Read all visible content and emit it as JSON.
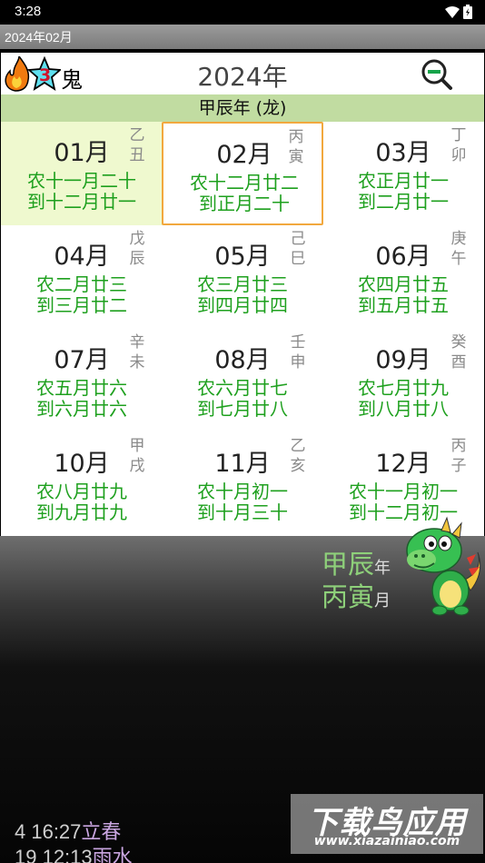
{
  "status_bar": {
    "time": "3:28"
  },
  "title_bar": {
    "title": "2024年02月"
  },
  "header": {
    "logo_text": "鬼",
    "logo_badge": "3",
    "year_title": "2024年",
    "zoom_icon": "zoom-out-icon"
  },
  "ganzhi_bar": {
    "text": "甲辰年 (龙)"
  },
  "months": [
    {
      "name": "01月",
      "gz1": "乙",
      "gz2": "丑",
      "line1": "农十一月二十",
      "line2": "到十二月廿一",
      "selected": true
    },
    {
      "name": "02月",
      "gz1": "丙",
      "gz2": "寅",
      "line1": "农十二月廿二",
      "line2": "到正月二十",
      "current": true
    },
    {
      "name": "03月",
      "gz1": "丁",
      "gz2": "卯",
      "line1": "农正月廿一",
      "line2": "到二月廿一"
    },
    {
      "name": "04月",
      "gz1": "戊",
      "gz2": "辰",
      "line1": "农二月廿三",
      "line2": "到三月廿二"
    },
    {
      "name": "05月",
      "gz1": "己",
      "gz2": "巳",
      "line1": "农三月廿三",
      "line2": "到四月廿四"
    },
    {
      "name": "06月",
      "gz1": "庚",
      "gz2": "午",
      "line1": "农四月廿五",
      "line2": "到五月廿五"
    },
    {
      "name": "07月",
      "gz1": "辛",
      "gz2": "未",
      "line1": "农五月廿六",
      "line2": "到六月廿六"
    },
    {
      "name": "08月",
      "gz1": "壬",
      "gz2": "申",
      "line1": "农六月廿七",
      "line2": "到七月廿八"
    },
    {
      "name": "09月",
      "gz1": "癸",
      "gz2": "酉",
      "line1": "农七月廿九",
      "line2": "到八月廿八"
    },
    {
      "name": "10月",
      "gz1": "甲",
      "gz2": "戌",
      "line1": "农八月廿九",
      "line2": "到九月廿九"
    },
    {
      "name": "11月",
      "gz1": "乙",
      "gz2": "亥",
      "line1": "农十月初一",
      "line2": "到十月三十"
    },
    {
      "name": "12月",
      "gz1": "丙",
      "gz2": "子",
      "line1": "农十一月初一",
      "line2": "到十二月初一"
    }
  ],
  "bottom": {
    "year_gz": "甲辰",
    "year_suffix": "年",
    "month_gz": "丙寅",
    "month_suffix": "月",
    "terms": [
      {
        "time": "4 16:27",
        "name": "立春"
      },
      {
        "time": "19 12:13",
        "name": "雨水"
      }
    ]
  },
  "watermark": {
    "line1": "下载鸟应用",
    "line2": "www.xiazainiao.com"
  },
  "colors": {
    "selected_bg": "#eff9cf",
    "current_border": "#f2a83e",
    "lunar_green": "#1ea01e",
    "ganzhi_bar": "#c1dca1",
    "term_purple": "#c9a5e0"
  }
}
